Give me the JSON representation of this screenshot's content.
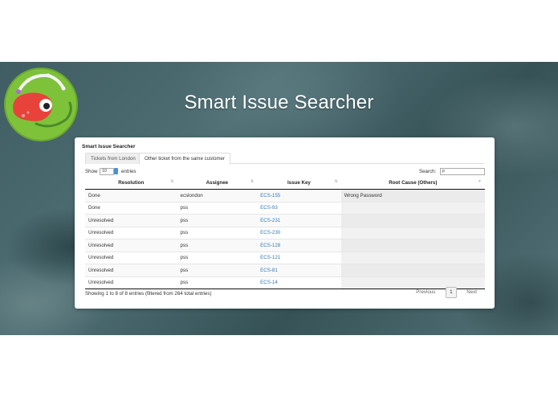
{
  "headline": "Smart Issue Searcher",
  "panel": {
    "title": "Smart Issue Searcher",
    "tabs": [
      "Tickets from London",
      "Other ticket from the same customer"
    ],
    "show_label": "Show",
    "entries_value": "10",
    "entries_label": "entries",
    "search_label": "Search:",
    "search_value": "p",
    "columns": [
      "Resolution",
      "Assignee",
      "Issue Key",
      "Root Cause (Others)"
    ],
    "rows": [
      [
        "Done",
        "ecslondon",
        "ECS-155",
        "Wrong Password"
      ],
      [
        "Done",
        "pss",
        "ECS-93",
        ""
      ],
      [
        "Unresolved",
        "pss",
        "ECS-231",
        ""
      ],
      [
        "Unresolved",
        "pss",
        "ECS-230",
        ""
      ],
      [
        "Unresolved",
        "pss",
        "ECS-128",
        ""
      ],
      [
        "Unresolved",
        "pss",
        "ECS-121",
        ""
      ],
      [
        "Unresolved",
        "pss",
        "ECS-81",
        ""
      ],
      [
        "Unresolved",
        "pss",
        "ECS-14",
        ""
      ]
    ],
    "info": "Showing 1 to 8 of 8 entries (filtered from 264 total entries)",
    "pager": {
      "previous": "Previous",
      "current": "1",
      "next": "Next"
    }
  },
  "colors": {
    "link": "#337ab7",
    "accent": "#4a90d9"
  }
}
